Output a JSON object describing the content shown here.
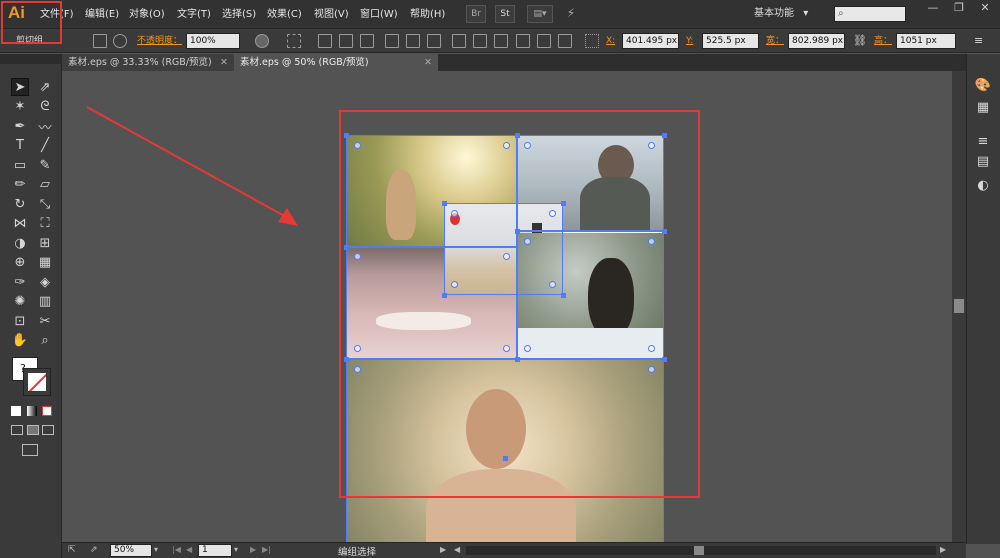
{
  "app": {
    "logo": "Ai"
  },
  "menus": [
    "文件(F)",
    "编辑(E)",
    "对象(O)",
    "文字(T)",
    "选择(S)",
    "效果(C)",
    "视图(V)",
    "窗口(W)",
    "帮助(H)"
  ],
  "menubar_buttons": {
    "br": "Br",
    "st": "St"
  },
  "workspace": {
    "label": "基本功能",
    "arrow": "▾"
  },
  "window_buttons": {
    "minimize": "—",
    "restore": "❐",
    "close": "✕"
  },
  "control_bar": {
    "selection_label": "剪切组",
    "opacity_label": "不透明度：",
    "opacity_value": "100%",
    "x_label": "X:",
    "x_value": "401.495 px",
    "y_label": "Y:",
    "y_value": "525.5 px",
    "w_label": "宽：",
    "w_value": "802.989 px",
    "h_label": "高：",
    "h_value": "1051 px"
  },
  "tabs": [
    {
      "label": "素材.eps @ 33.33% (RGB/预览)",
      "close": "✕"
    },
    {
      "label": "素材.eps @ 50% (RGB/预览)",
      "close": "✕"
    }
  ],
  "status_bar": {
    "zoom": "50%",
    "page": "1",
    "status_text": "编组选择"
  },
  "colors": {
    "accent": "#f7941d",
    "selection": "#4d7cff",
    "annotation": "#e53935"
  },
  "icons": {
    "tools": [
      "selection-tool-icon",
      "direct-selection-tool-icon",
      "magic-wand-icon",
      "lasso-icon",
      "pen-icon",
      "curvature-icon",
      "type-icon",
      "line-icon",
      "rectangle-icon",
      "paintbrush-icon",
      "pencil-icon",
      "eraser-icon",
      "rotate-icon",
      "scale-icon",
      "width-icon",
      "free-transform-icon",
      "shape-builder-icon",
      "perspective-icon",
      "mesh-icon",
      "gradient-icon",
      "eyedropper-icon",
      "blend-icon",
      "symbol-sprayer-icon",
      "column-graph-icon",
      "artboard-icon",
      "slice-icon",
      "hand-icon",
      "zoom-icon"
    ],
    "panels": [
      "color-panel-icon",
      "libraries-panel-icon",
      "stroke-panel-icon",
      "gradient-panel-icon",
      "transparency-panel-icon"
    ]
  }
}
